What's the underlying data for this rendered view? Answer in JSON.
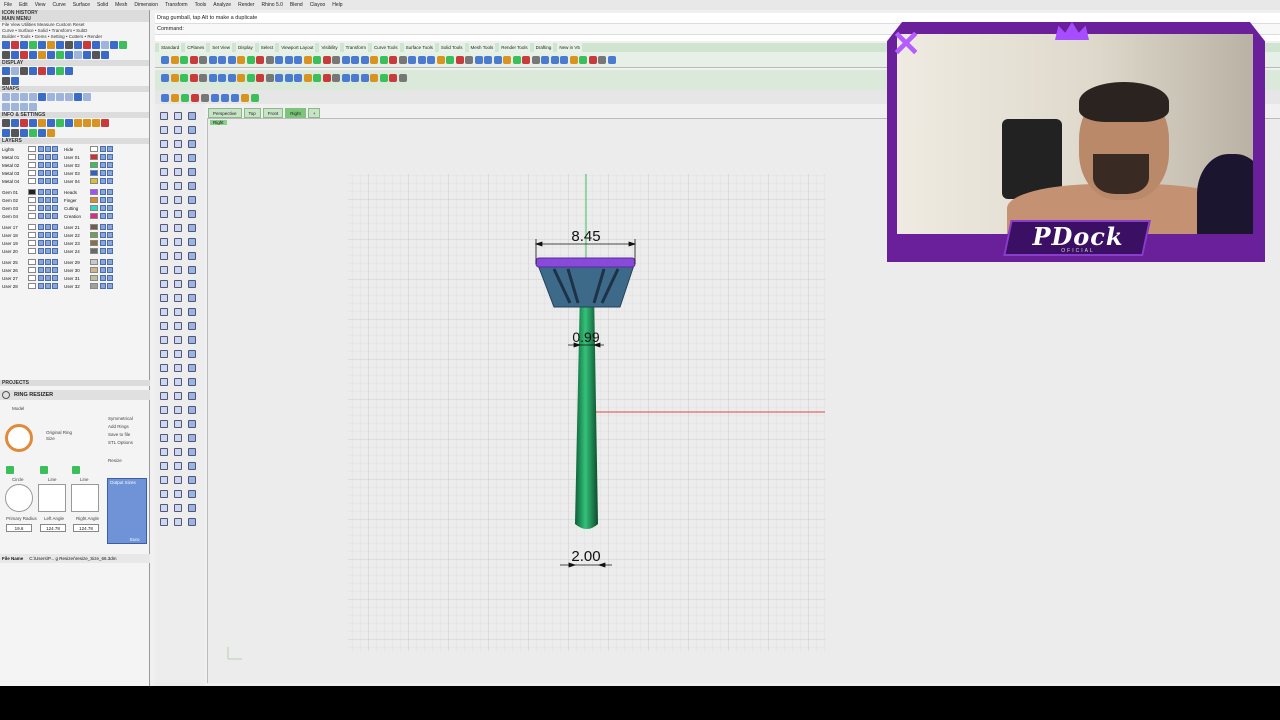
{
  "menubar": {
    "items": [
      "File",
      "Edit",
      "View",
      "Curve",
      "Surface",
      "Solid",
      "Mesh",
      "Dimension",
      "Transform",
      "Tools",
      "Analyze",
      "Render",
      "Rhino 5.0",
      "Blend",
      "Clayoo",
      "Help"
    ]
  },
  "leftpanel": {
    "icon_history": "ICON HISTORY",
    "main_menu": "MAIN MENU",
    "main_menu_items": "File  View  Utilities  Measure  Custom      Reset",
    "main_sub": "Curve • Surface • Solid • Transform • SubD",
    "main_sub2": "Builder • Tools • Gems • Setting • Cutters • Render",
    "display": "DISPLAY",
    "snaps": "SNAPS",
    "info": "INFO & SETTINGS",
    "layers": "LAYERS",
    "projects": "PROJECTS",
    "layers_left": [
      "Lights",
      "Metal 01",
      "Metal 02",
      "Metal 03",
      "Metal 04",
      "Gem 01",
      "Gem 02",
      "Gem 03",
      "Gem 04",
      "User 17",
      "User 18",
      "User 19",
      "User 20",
      "User 25",
      "User 26",
      "User 27",
      "User 28"
    ],
    "layers_right": [
      "Hide",
      "User 01",
      "User 02",
      "User 03",
      "User 04",
      "Heads",
      "Finger",
      "Cutting",
      "Creation",
      "User 21",
      "User 22",
      "User 23",
      "User 24",
      "User 29",
      "User 30",
      "User 31",
      "User 32"
    ]
  },
  "ring_resizer": {
    "title": "RING RESIZER",
    "model_label": "Model",
    "original_ring": "Original Ring",
    "size_label": "Size",
    "options": [
      "Symmetrical",
      "Add Rings",
      "Save to file",
      "STL Options"
    ],
    "resize_label": "Resize",
    "output_sizes": "Output Sizes",
    "shapes": [
      "Circle",
      "Line",
      "Line"
    ],
    "labels": [
      "Primary Radius",
      "Left Angle",
      "Right Angle"
    ],
    "values": [
      "19.6",
      "124.78",
      "124.78"
    ],
    "euro": "Euro",
    "file_name_label": "File Name",
    "file_name_value": "C:\\Users\\P... g Resizer\\resize_Size_66.3dm"
  },
  "command": {
    "prompt_text": "Drag gumball, tap Alt to make a duplicate",
    "command_label": "Command:"
  },
  "toolbar_tabs": [
    "Standard",
    "CPlanes",
    "Set View",
    "Display",
    "Select",
    "Viewport Layout",
    "Visibility",
    "Transform",
    "Curve Tools",
    "Surface Tools",
    "Solid Tools",
    "Mesh Tools",
    "Render Tools",
    "Drafting",
    "New in V5"
  ],
  "viewport_tabs": [
    "Perspective",
    "Top",
    "Front",
    "Right"
  ],
  "viewport_active": "Right",
  "viewport_label": "Right",
  "dimensions": {
    "top_width": "8.45",
    "mid_width": "0.99",
    "bottom_width": "2.00"
  },
  "colors": {
    "shank": "#1f9a5a",
    "head": "#3e6a8a",
    "prongs": "#8a4ad9",
    "axis_red": "#d94a4a",
    "axis_green": "#3bbf5a"
  },
  "webcam": {
    "brand": "PDock",
    "brand_sub": "OFICIAL"
  }
}
